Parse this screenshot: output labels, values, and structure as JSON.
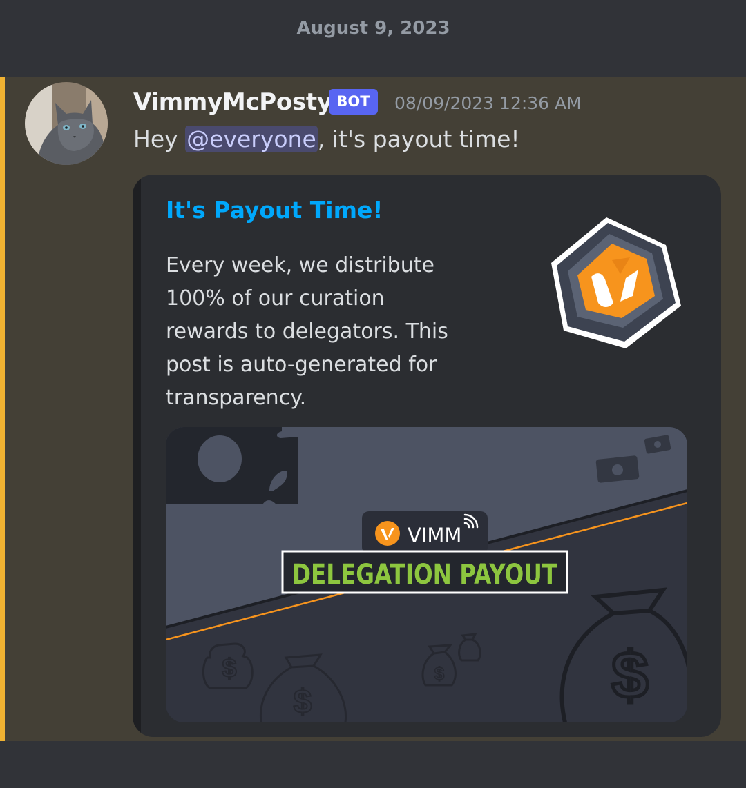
{
  "divider": {
    "date": "August 9, 2023"
  },
  "message": {
    "username": "VimmyMcPosty",
    "bot_tag": "BOT",
    "timestamp": "08/09/2023 12:36 AM",
    "content_prefix": "Hey ",
    "mention": "@everyone",
    "content_suffix": ", it's payout time!"
  },
  "embed": {
    "title": "It's Payout Time!",
    "description": "Every week, we distribute 100% of our curation rewards to delegators. This post is auto-generated for transparency.",
    "thumbnail_icon": "vimm-hexagon-logo",
    "image": {
      "brand": "VIMM",
      "headline": "DELEGATION PAYOUT"
    }
  },
  "colors": {
    "accent_mention": "#f0b232",
    "bot_tag": "#5865f2",
    "embed_title": "#00a8fc",
    "headline_green": "#8dc63f",
    "vimm_orange": "#f7941d"
  }
}
